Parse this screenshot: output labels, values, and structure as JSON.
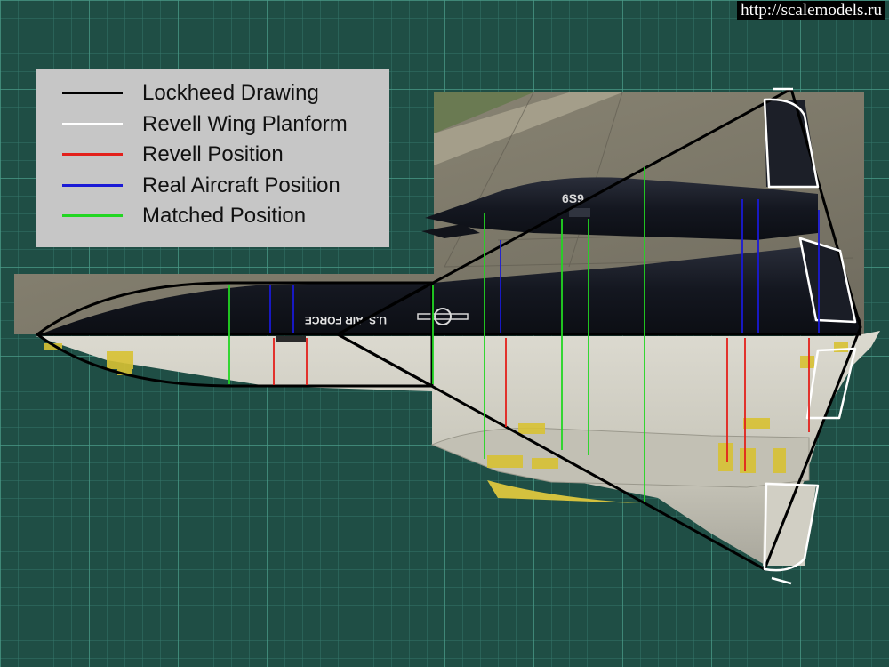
{
  "watermark": "http://scalemodels.ru",
  "legend": [
    {
      "label": "Lockheed Drawing",
      "color": "#000000"
    },
    {
      "label": "Revell Wing Planform",
      "color": "#ffffff"
    },
    {
      "label": "Revell Position",
      "color": "#e3201b"
    },
    {
      "label": "Real Aircraft Position",
      "color": "#1a1ad6"
    },
    {
      "label": "Matched Position",
      "color": "#22d622"
    }
  ],
  "aircraft_markings": {
    "fuselage_text": "U.S. AIR FORCE",
    "tail_number": "6S9"
  },
  "colors": {
    "mat_green": "#1f4e45",
    "grid_line": "#3d8a7a",
    "real_aircraft": "#14161d",
    "model_grey": "#c9c7bc",
    "yellow_tape": "#d8c234"
  }
}
